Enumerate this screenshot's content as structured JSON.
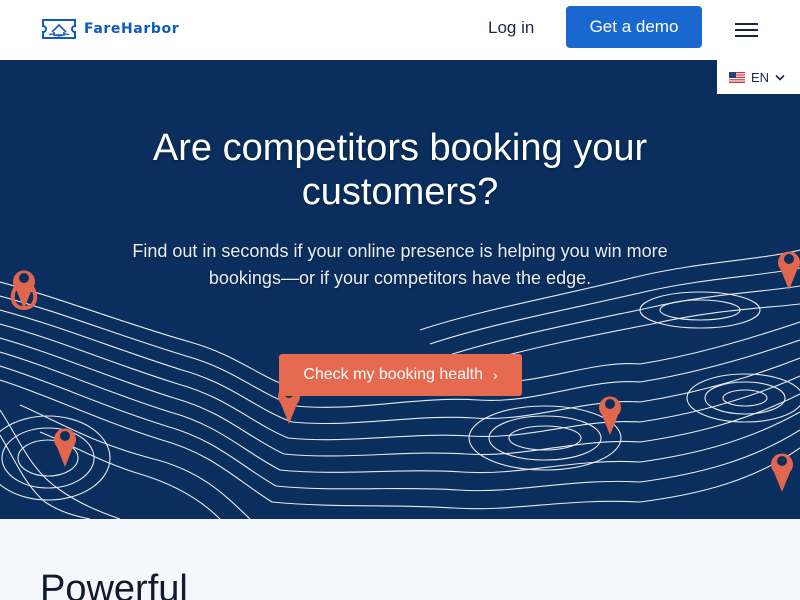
{
  "header": {
    "logo_text": "FareHarbor",
    "login_label": "Log in",
    "demo_label": "Get a demo",
    "menu_icon": "hamburger-menu-icon"
  },
  "language": {
    "label": "EN",
    "flag_icon": "us-flag-icon",
    "chevron_icon": "chevron-down-icon"
  },
  "hero": {
    "title": "Are competitors booking your customers?",
    "subtitle": "Find out in seconds if your online presence is helping you win more bookings—or if your competitors have the edge.",
    "cta_label": "Check my booking health",
    "cta_icon": "›",
    "background": "topographic-map-lines",
    "pin_icon": "map-pin-icon"
  },
  "section": {
    "title": "Powerful"
  },
  "colors": {
    "brand_blue": "#0c5bc2",
    "button_blue": "#1868cf",
    "hero_navy": "#0a2f5e",
    "cta_coral": "#e66a50",
    "pin_coral": "#e0674d",
    "section_bg": "#f4f7fb"
  }
}
